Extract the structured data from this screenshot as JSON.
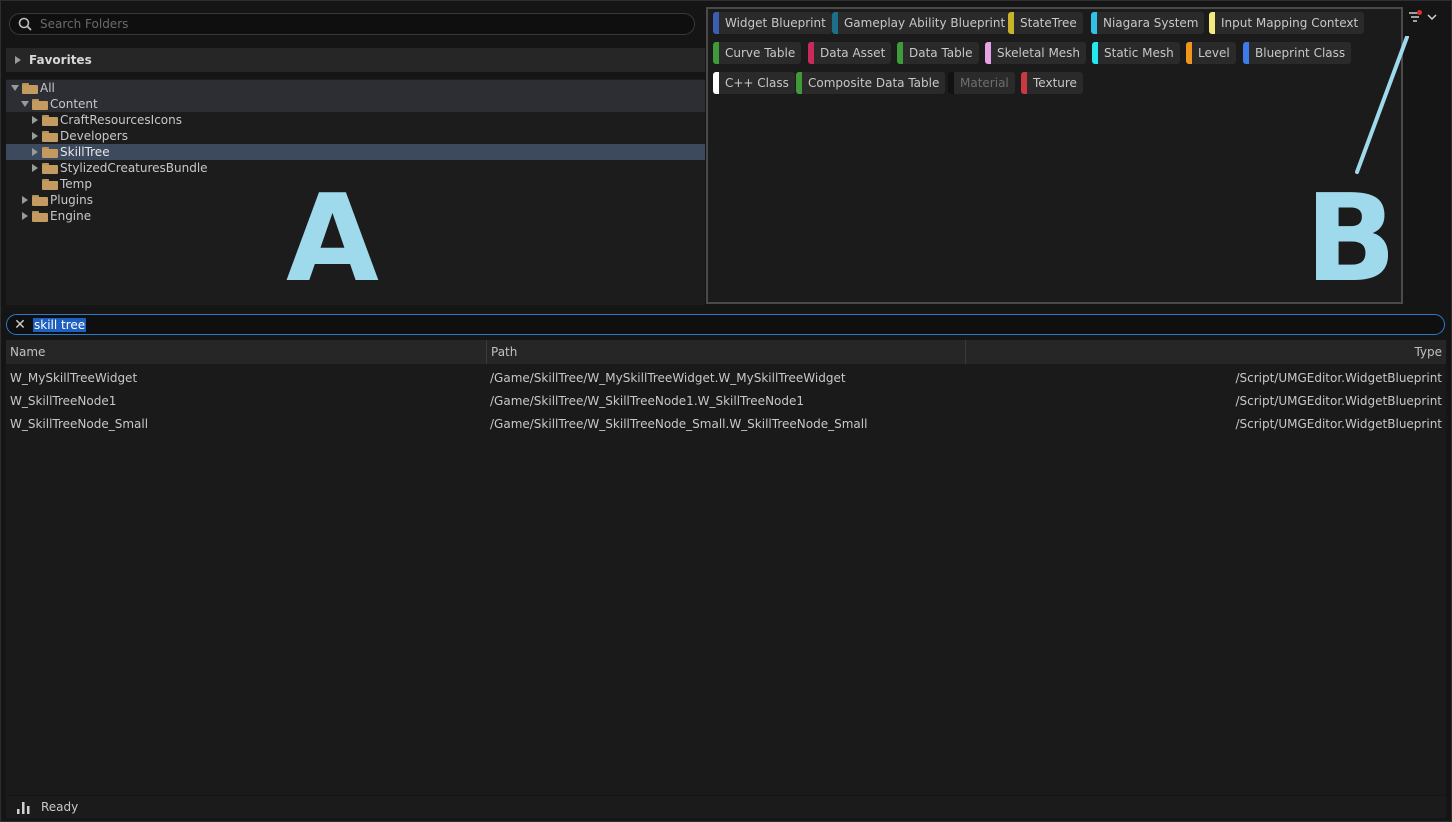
{
  "folder_search": {
    "placeholder": "Search Folders"
  },
  "favorites": {
    "label": "Favorites"
  },
  "tree": [
    {
      "label": "All"
    },
    {
      "label": "Content"
    },
    {
      "label": "CraftResourcesIcons"
    },
    {
      "label": "Developers"
    },
    {
      "label": "SkillTree"
    },
    {
      "label": "StylizedCreaturesBundle"
    },
    {
      "label": "Temp"
    },
    {
      "label": "Plugins"
    },
    {
      "label": "Engine"
    }
  ],
  "annotations": {
    "a": "A",
    "b": "B"
  },
  "filters": [
    {
      "label": "Widget Blueprint",
      "color": "#3a5fb0"
    },
    {
      "label": "Gameplay Ability Blueprint",
      "color": "#1d6f87"
    },
    {
      "label": "StateTree",
      "color": "#c9b32a"
    },
    {
      "label": "Niagara System",
      "color": "#2fc1e8"
    },
    {
      "label": "Input Mapping Context",
      "color": "#f2ea7e"
    },
    {
      "label": "Curve Table",
      "color": "#3f9a3a"
    },
    {
      "label": "Data Asset",
      "color": "#c92a5a"
    },
    {
      "label": "Data Table",
      "color": "#3f9a3a"
    },
    {
      "label": "Skeletal Mesh",
      "color": "#e7a2e6"
    },
    {
      "label": "Static Mesh",
      "color": "#24e7f0"
    },
    {
      "label": "Level",
      "color": "#f0961e"
    },
    {
      "label": "Blueprint Class",
      "color": "#3c7be8"
    },
    {
      "label": "C++ Class",
      "color": "#ffffff"
    },
    {
      "label": "Composite Data Table",
      "color": "#3f9a3a"
    },
    {
      "label": "Material",
      "color": "#111111"
    },
    {
      "label": "Texture",
      "color": "#c9393f"
    }
  ],
  "asset_search": {
    "value": "skill tree"
  },
  "table": {
    "headers": {
      "name": "Name",
      "path": "Path",
      "type": "Type"
    },
    "rows": [
      {
        "name": "W_MySkillTreeWidget",
        "path": "/Game/SkillTree/W_MySkillTreeWidget.W_MySkillTreeWidget",
        "type": "/Script/UMGEditor.WidgetBlueprint"
      },
      {
        "name": "W_SkillTreeNode1",
        "path": "/Game/SkillTree/W_SkillTreeNode1.W_SkillTreeNode1",
        "type": "/Script/UMGEditor.WidgetBlueprint"
      },
      {
        "name": "W_SkillTreeNode_Small",
        "path": "/Game/SkillTree/W_SkillTreeNode_Small.W_SkillTreeNode_Small",
        "type": "/Script/UMGEditor.WidgetBlueprint"
      }
    ]
  },
  "status": {
    "label": "Ready"
  }
}
